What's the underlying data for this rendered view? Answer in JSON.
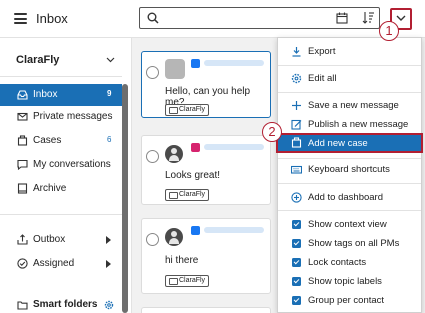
{
  "header": {
    "title": "Inbox",
    "menu_icon": "hamburger-icon",
    "search_icon": "search-icon",
    "calendar_icon": "calendar-icon",
    "sort_icon": "sort-icon",
    "dropdown_icon": "chevron-down-icon"
  },
  "callouts": {
    "first": "1",
    "second": "2"
  },
  "sidebar": {
    "org_name": "ClaraFly",
    "items": [
      {
        "label": "Inbox",
        "count": "9",
        "icon": "inbox-icon",
        "active": true
      },
      {
        "label": "Private messages",
        "count": "",
        "icon": "mail-icon"
      },
      {
        "label": "Cases",
        "count": "6",
        "icon": "briefcase-icon"
      },
      {
        "label": "My conversations",
        "count": "",
        "icon": "chat-icon"
      },
      {
        "label": "Archive",
        "count": "",
        "icon": "archive-icon"
      },
      {
        "label": "Outbox",
        "count": "",
        "icon": "outbox-icon"
      },
      {
        "label": "Assigned",
        "count": "",
        "icon": "check-circle-icon"
      }
    ],
    "smart_folders": "Smart folders"
  },
  "messages": [
    {
      "text": "Hello, can you help me?",
      "tag": "ClaraFly",
      "platform": "facebook",
      "selected": true
    },
    {
      "text": "Looks great!",
      "tag": "ClaraFly",
      "platform": "instagram",
      "selected": false
    },
    {
      "text": "hi there",
      "tag": "ClaraFly",
      "platform": "facebook",
      "selected": false
    }
  ],
  "menu": {
    "export": "Export",
    "edit_all": "Edit all",
    "save_message": "Save a new message",
    "publish_message": "Publish a new message",
    "add_case": "Add new case",
    "keyboard_shortcuts": "Keyboard shortcuts",
    "add_dashboard": "Add to dashboard",
    "options": [
      {
        "label": "Show context view",
        "checked": true
      },
      {
        "label": "Show tags on all PMs",
        "checked": true
      },
      {
        "label": "Lock contacts",
        "checked": true
      },
      {
        "label": "Show topic labels",
        "checked": true
      },
      {
        "label": "Group per contact",
        "checked": true
      }
    ]
  },
  "colors": {
    "accent": "#1a6fb5",
    "annotation": "#b21f32",
    "facebook": "#1877f2",
    "instagram": "#d6246e"
  }
}
